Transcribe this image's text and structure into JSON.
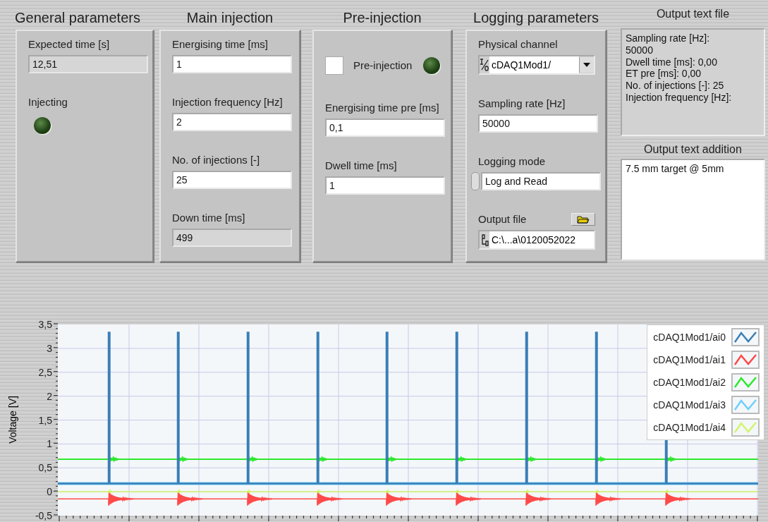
{
  "general_parameters": {
    "title": "General parameters",
    "expected_time": {
      "label": "Expected time [s]",
      "value": "12,51"
    },
    "injecting": {
      "label": "Injecting",
      "on": false
    }
  },
  "main_injection": {
    "title": "Main injection",
    "fields": [
      {
        "label": "Energising time [ms]",
        "value": "1",
        "kind": "control"
      },
      {
        "label": "Injection frequency [Hz]",
        "value": "2",
        "kind": "control"
      },
      {
        "label": "No. of injections [-]",
        "value": "25",
        "kind": "control"
      },
      {
        "label": "Down time [ms]",
        "value": "499",
        "kind": "indicator"
      }
    ]
  },
  "pre_injection": {
    "title": "Pre-injection",
    "checkbox": {
      "label": "Pre-injection",
      "checked": false
    },
    "led": {
      "on": false
    },
    "fields": [
      {
        "label": "Energising time pre [ms]",
        "value": "0,1",
        "kind": "control"
      },
      {
        "label": "Dwell time [ms]",
        "value": "1",
        "kind": "control"
      }
    ]
  },
  "logging_parameters": {
    "title": "Logging parameters",
    "physical_channel": {
      "label": "Physical channel",
      "value": "cDAQ1Mod1/"
    },
    "sampling_rate": {
      "label": "Sampling rate [Hz]",
      "value": "50000"
    },
    "logging_mode": {
      "label": "Logging mode",
      "value": "Log and Read"
    },
    "output_file": {
      "label": "Output file",
      "value": "C:\\...a\\0120052022"
    }
  },
  "output_text_file": {
    "title": "Output text file",
    "text": "Sampling rate [Hz]:\n50000\nDwell time [ms]: 0,00\nET pre [ms]: 0,00\nNo. of injections [-]: 25\nInjection frequency [Hz]:"
  },
  "output_text_addition": {
    "title": "Output text addition",
    "text": "7.5 mm target @ 5mm"
  },
  "graph": {
    "ylabel": "Voltage [V]",
    "yticks": [
      "3,5",
      "3",
      "2,5",
      "2",
      "1,5",
      "1",
      "0,5",
      "0",
      "-0,5"
    ],
    "legend": [
      {
        "name": "cDAQ1Mod1/ai0",
        "color": "#3a7fb8"
      },
      {
        "name": "cDAQ1Mod1/ai1",
        "color": "#ff4a4a"
      },
      {
        "name": "cDAQ1Mod1/ai2",
        "color": "#2ee82e"
      },
      {
        "name": "cDAQ1Mod1/ai3",
        "color": "#6fcfff"
      },
      {
        "name": "cDAQ1Mod1/ai4",
        "color": "#d2f56a"
      }
    ]
  }
}
